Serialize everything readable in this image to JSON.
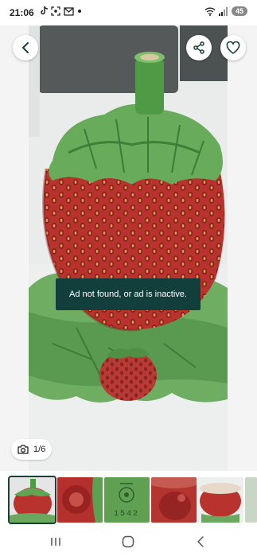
{
  "status_bar": {
    "time": "21:06",
    "left_icons": [
      "tiktok-icon",
      "screenshot-icon",
      "gmail-icon",
      "dot-icon"
    ],
    "battery": "45"
  },
  "header": {
    "back_icon": "chevron-left-icon",
    "share_icon": "share-icon",
    "favorite_icon": "heart-icon"
  },
  "toast": {
    "message": "Ad not found, or ad is inactive."
  },
  "gallery": {
    "counter": "1/6",
    "thumbnails": [
      {
        "name": "strawberry-pot-front",
        "active": true
      },
      {
        "name": "lid-underside",
        "active": false
      },
      {
        "name": "maker-mark",
        "active": false
      },
      {
        "name": "base-view",
        "active": false
      },
      {
        "name": "strawberry-bowl",
        "active": false
      }
    ],
    "thumbnail_mark_text": "1542"
  },
  "nav": {
    "items": [
      "recents-icon",
      "home-icon",
      "back-icon"
    ]
  },
  "colors": {
    "accent": "#123f3c",
    "strawberry": "#b8322e",
    "leaf": "#5aa152"
  }
}
